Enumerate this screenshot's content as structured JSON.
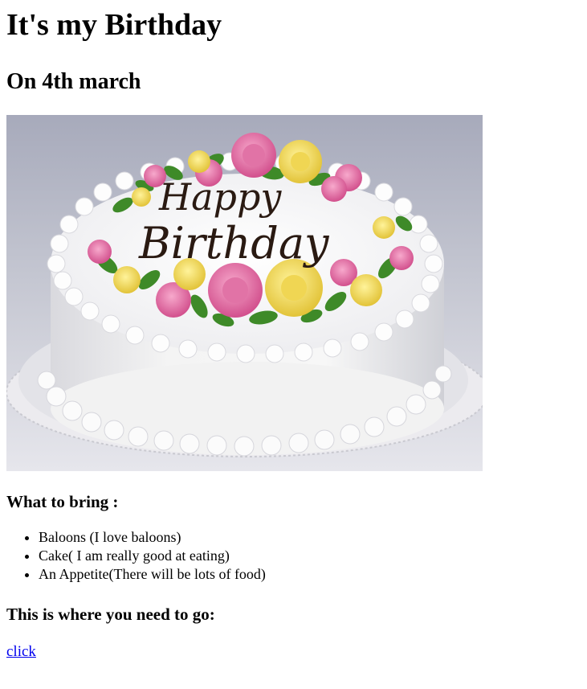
{
  "header": {
    "title": "It's my Birthday",
    "date_heading": "On 4th march"
  },
  "image": {
    "icon": "birthday-cake-photo",
    "inscription_line1": "Happy",
    "inscription_line2": "Birthday"
  },
  "bring_section": {
    "heading": "What to bring :",
    "items": [
      "Baloons (I love baloons)",
      "Cake( I am really good at eating)",
      "An Appetite(There will be lots of food)"
    ]
  },
  "location_section": {
    "heading": "This is where you need to go:",
    "link_label": "click"
  },
  "colors": {
    "link": "#0000ee",
    "text": "#000000",
    "background": "#ffffff"
  }
}
